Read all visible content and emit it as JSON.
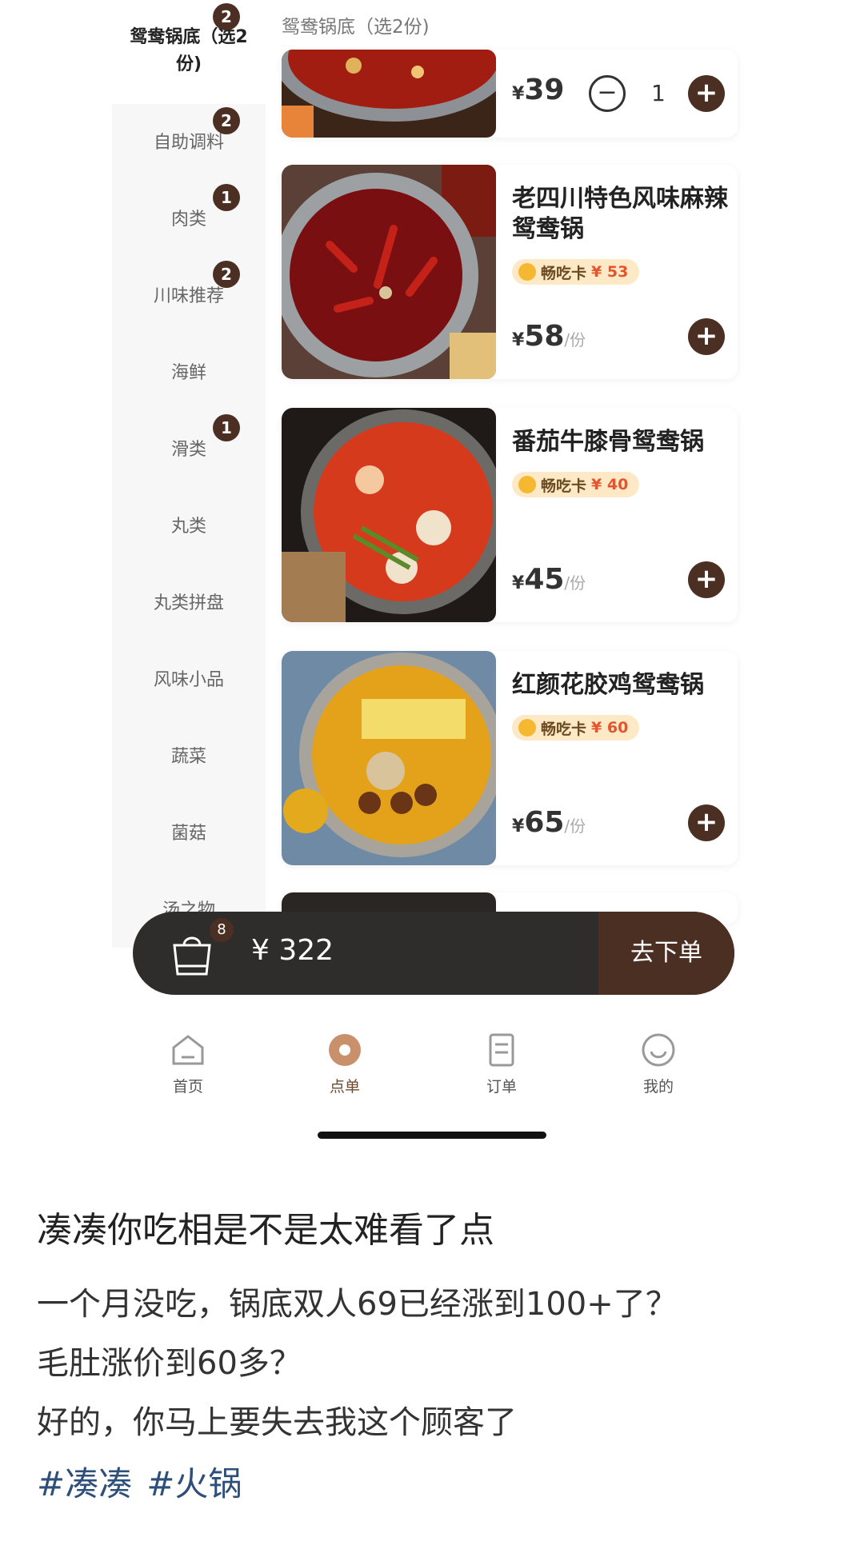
{
  "sidebar": {
    "items": [
      {
        "label": "鸳鸯锅底（选2份)",
        "badge": "2"
      },
      {
        "label": "自助调料",
        "badge": "2"
      },
      {
        "label": "肉类",
        "badge": "1"
      },
      {
        "label": "川味推荐",
        "badge": "2"
      },
      {
        "label": "海鲜",
        "badge": ""
      },
      {
        "label": "滑类",
        "badge": "1"
      },
      {
        "label": "丸类",
        "badge": ""
      },
      {
        "label": "丸类拼盘",
        "badge": ""
      },
      {
        "label": "风味小品",
        "badge": ""
      },
      {
        "label": "蔬菜",
        "badge": ""
      },
      {
        "label": "菌菇",
        "badge": ""
      },
      {
        "label": "汤之物",
        "badge": ""
      }
    ]
  },
  "section_title": "鸳鸯锅底（选2份)",
  "dishes": [
    {
      "name": "",
      "price_currency": "¥",
      "price": "39",
      "unit": "",
      "quantity": "1",
      "vip_label": "",
      "vip_price": ""
    },
    {
      "name": "老四川特色风味麻辣鸳鸯锅",
      "price_currency": "¥",
      "price": "58",
      "unit": "/份",
      "vip_label": "畅吃卡",
      "vip_price": "¥ 53"
    },
    {
      "name": "番茄牛膝骨鸳鸯锅",
      "price_currency": "¥",
      "price": "45",
      "unit": "/份",
      "vip_label": "畅吃卡",
      "vip_price": "¥ 40"
    },
    {
      "name": "红颜花胶鸡鸳鸯锅",
      "price_currency": "¥",
      "price": "65",
      "unit": "/份",
      "vip_label": "畅吃卡",
      "vip_price": "¥ 60"
    }
  ],
  "icons": {
    "add": "plus-icon",
    "minus": "minus-icon",
    "cart": "shopping-bag-icon"
  },
  "cart": {
    "count": "8",
    "total": "¥ 322",
    "checkout_label": "去下单"
  },
  "tabbar": {
    "items": [
      {
        "label": "首页",
        "icon": "home-icon"
      },
      {
        "label": "点单",
        "icon": "order-icon"
      },
      {
        "label": "订单",
        "icon": "receipt-icon"
      },
      {
        "label": "我的",
        "icon": "profile-icon"
      }
    ]
  },
  "post": {
    "title": "凑凑你吃相是不是太难看了点",
    "lines": [
      "一个月没吃，锅底双人69已经涨到100+了？",
      "毛肚涨价到60多？",
      "好的，你马上要失去我这个顾客了"
    ],
    "hashtags": [
      "#凑凑",
      "#火锅"
    ]
  },
  "colors": {
    "brand_dark": "#4a2f22",
    "cart_bg": "#2f2d2c",
    "vip_bg": "#fde9c6",
    "vip_price": "#e2552f",
    "hashtag": "#2e4f7a"
  }
}
